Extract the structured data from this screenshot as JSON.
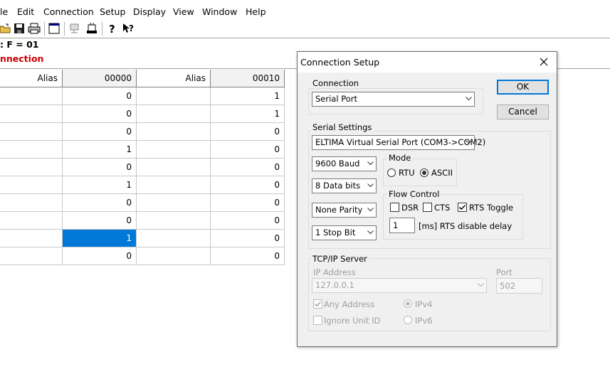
{
  "menu": [
    "le",
    "Edit",
    "Connection",
    "Setup",
    "Display",
    "View",
    "Window",
    "Help"
  ],
  "status": {
    "line1": ": F = 01",
    "line2": "nnection",
    "line2_color": "#cc0000"
  },
  "grid": {
    "headers": [
      "Alias",
      "00000",
      "Alias",
      "00010"
    ],
    "col1": [
      "0",
      "0",
      "0",
      "1",
      "0",
      "1",
      "0",
      "0",
      "1",
      "0"
    ],
    "col2": [
      "1",
      "1",
      "0",
      "0",
      "0",
      "0",
      "0",
      "0",
      "0",
      "0"
    ],
    "selected_row": 8,
    "selection_color": "#0078d7"
  },
  "dialog": {
    "title": "Connection Setup",
    "ok": "OK",
    "cancel": "Cancel",
    "connection": {
      "label": "Connection",
      "value": "Serial Port"
    },
    "serial": {
      "label": "Serial Settings",
      "port": "ELTIMA Virtual Serial Port (COM3->COM2)",
      "baud": "9600 Baud",
      "data_bits": "8 Data bits",
      "parity": "None Parity",
      "stop_bits": "1 Stop Bit",
      "mode": {
        "label": "Mode",
        "rtu": "RTU",
        "ascii": "ASCII",
        "selected": "ASCII"
      },
      "flow": {
        "label": "Flow Control",
        "dsr": "DSR",
        "cts": "CTS",
        "rts_toggle": "RTS Toggle",
        "rts_checked": true,
        "delay_value": "1",
        "delay_label": "[ms] RTS disable delay"
      }
    },
    "tcp": {
      "label": "TCP/IP Server",
      "ip_label": "IP Address",
      "ip_value": "127.0.0.1",
      "port_label": "Port",
      "port_value": "502",
      "any_address": "Any Address",
      "ignore_unit": "Ignore Unit ID",
      "ipv4": "IPv4",
      "ipv6": "IPv6"
    }
  }
}
